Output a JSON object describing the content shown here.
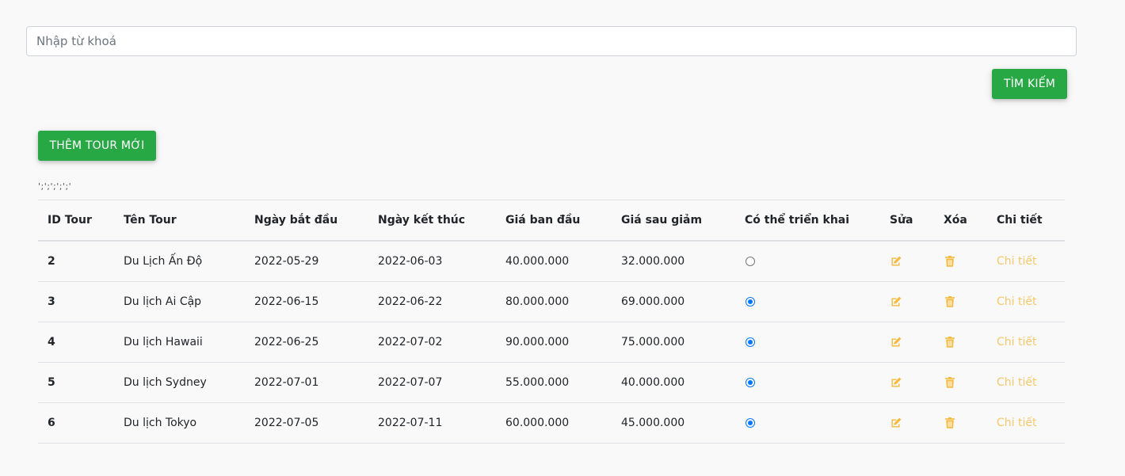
{
  "search": {
    "placeholder": "Nhập từ khoá",
    "value": "",
    "button_label": "TÌM KIẾM"
  },
  "add_button_label": "THÊM TOUR MỚI",
  "stray_text": "';';';';';'",
  "table": {
    "headers": [
      "ID Tour",
      "Tên Tour",
      "Ngày bắt đầu",
      "Ngày kết thúc",
      "Giá ban đầu",
      "Giá sau giảm",
      "Có thể triển khai",
      "Sửa",
      "Xóa",
      "Chi tiết"
    ],
    "rows": [
      {
        "id": "2",
        "name": "Du Lịch Ấn Độ",
        "start": "2022-05-29",
        "end": "2022-06-03",
        "price": "40.000.000",
        "discount_price": "32.000.000",
        "deployable": false,
        "detail": "Chi tiết"
      },
      {
        "id": "3",
        "name": "Du lịch Ai Cập",
        "start": "2022-06-15",
        "end": "2022-06-22",
        "price": "80.000.000",
        "discount_price": "69.000.000",
        "deployable": true,
        "detail": "Chi tiết"
      },
      {
        "id": "4",
        "name": "Du lịch Hawaii",
        "start": "2022-06-25",
        "end": "2022-07-02",
        "price": "90.000.000",
        "discount_price": "75.000.000",
        "deployable": true,
        "detail": "Chi tiết"
      },
      {
        "id": "5",
        "name": "Du lịch Sydney",
        "start": "2022-07-01",
        "end": "2022-07-07",
        "price": "55.000.000",
        "discount_price": "40.000.000",
        "deployable": true,
        "detail": "Chi tiết"
      },
      {
        "id": "6",
        "name": "Du lịch Tokyo",
        "start": "2022-07-05",
        "end": "2022-07-11",
        "price": "60.000.000",
        "discount_price": "45.000.000",
        "deployable": true,
        "detail": "Chi tiết"
      }
    ]
  },
  "icons": {
    "edit": "edit-icon",
    "delete": "trash-icon"
  },
  "colors": {
    "primary_button": "#28a745",
    "action_icon": "#f6b93b",
    "detail_link": "#f6c86a",
    "radio_checked": "#0075ff"
  }
}
